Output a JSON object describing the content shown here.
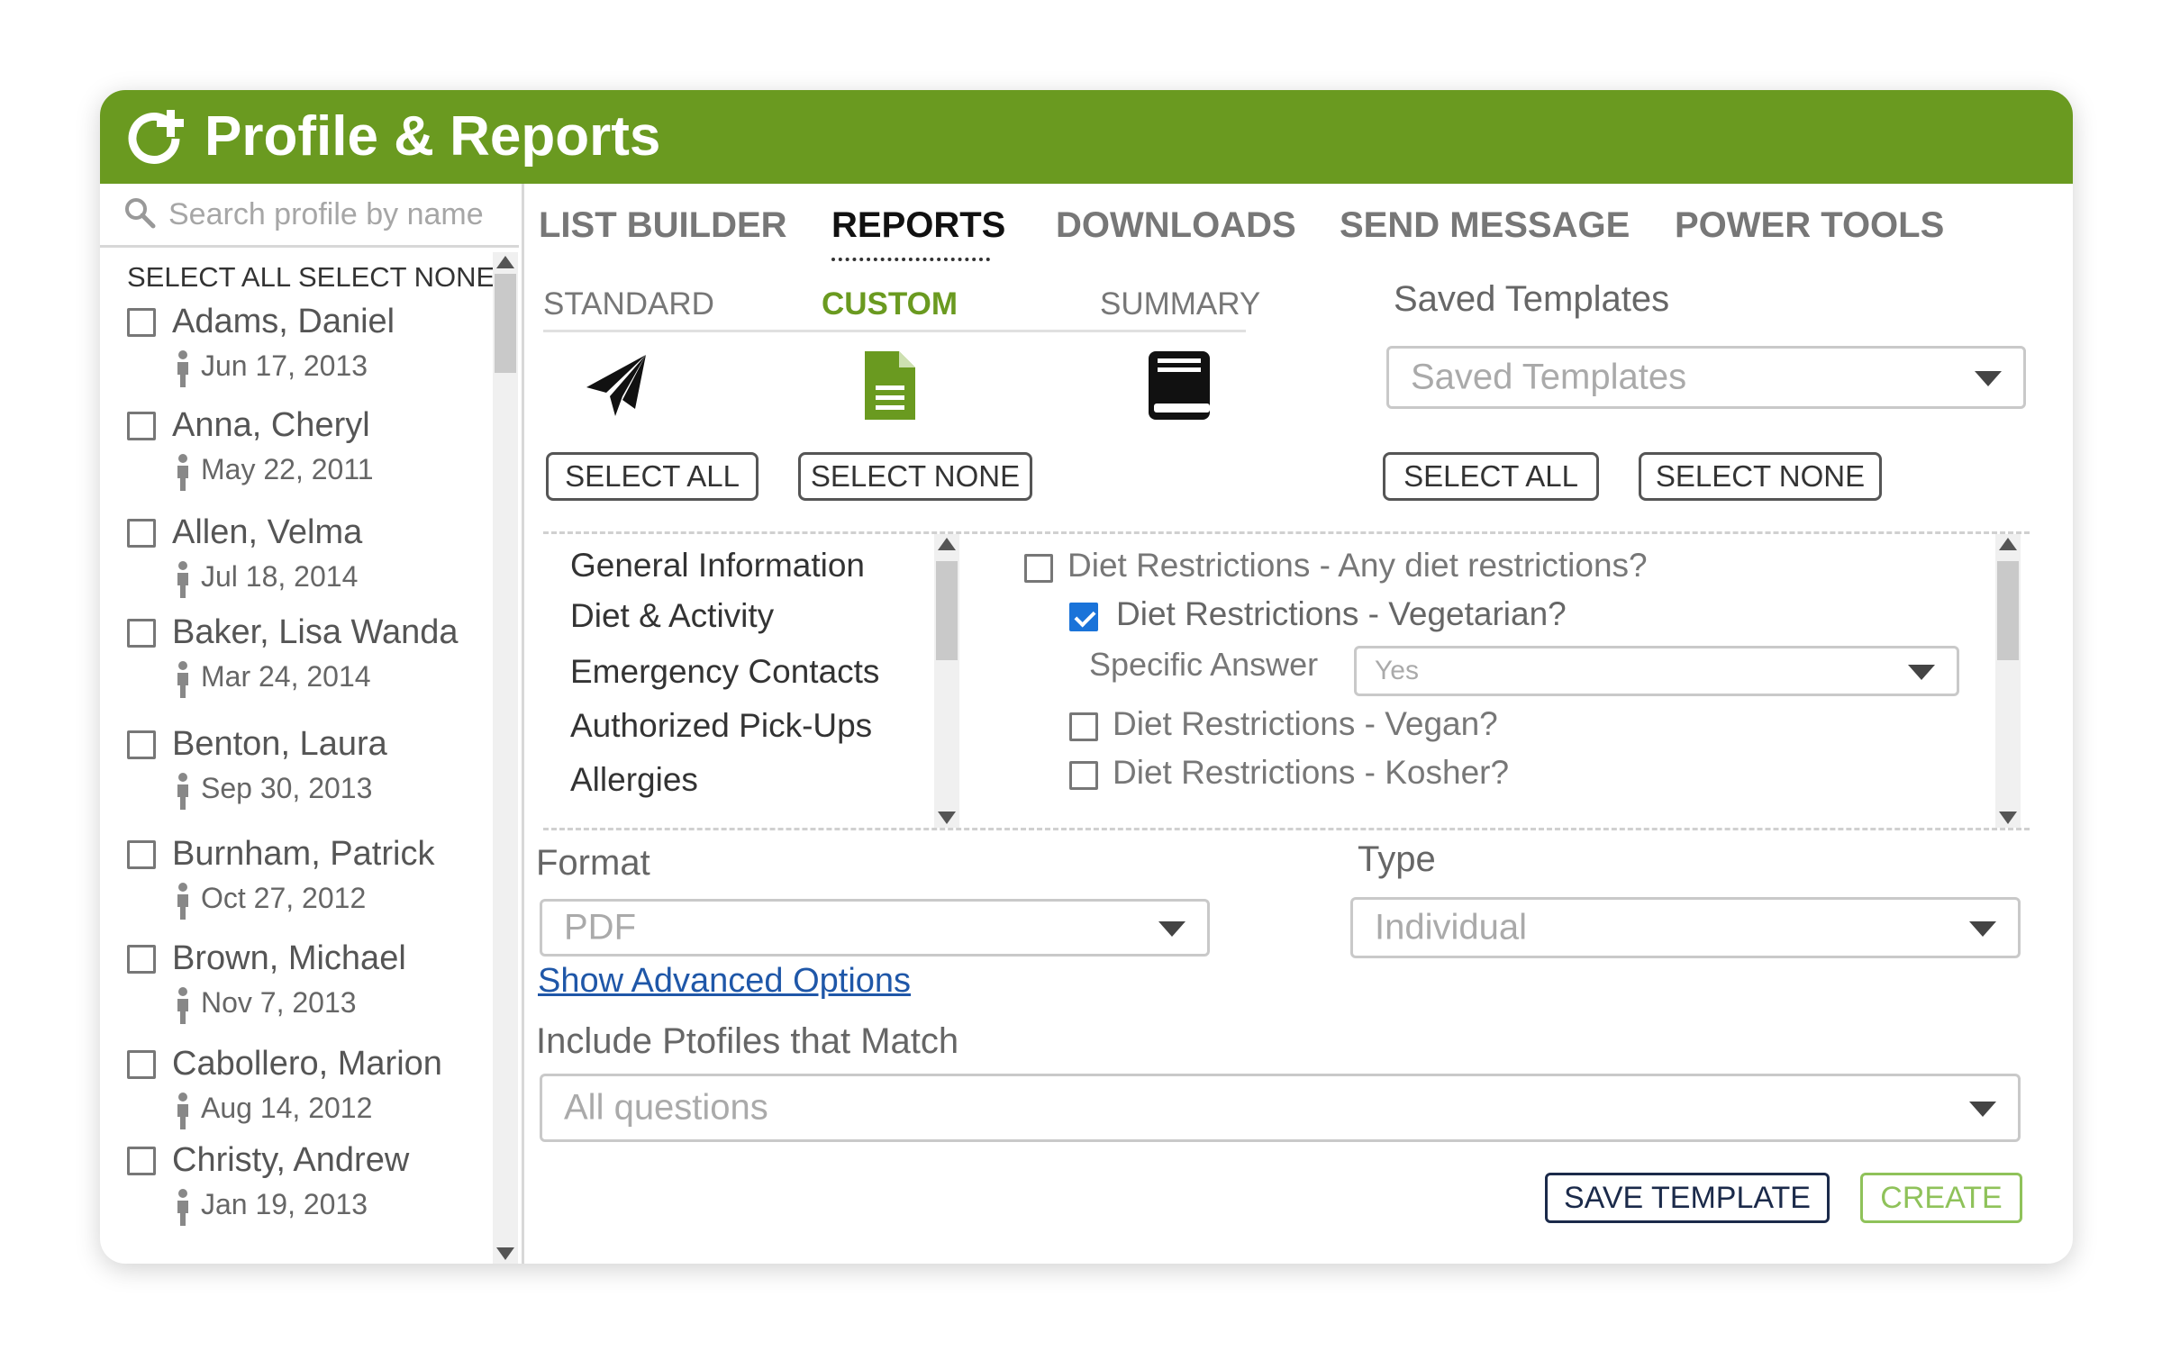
{
  "app": {
    "title": "Profile & Reports"
  },
  "sidebar": {
    "search_placeholder": "Search profile by name",
    "select_all": "SELECT ALL",
    "select_none": "SELECT NONE",
    "profiles": [
      {
        "name": "Adams, Daniel",
        "date": "Jun 17, 2013"
      },
      {
        "name": "Anna, Cheryl",
        "date": "May 22, 2011"
      },
      {
        "name": "Allen, Velma",
        "date": "Jul 18, 2014"
      },
      {
        "name": "Baker, Lisa Wanda",
        "date": "Mar 24, 2014"
      },
      {
        "name": "Benton, Laura",
        "date": "Sep 30, 2013"
      },
      {
        "name": "Burnham, Patrick",
        "date": "Oct 27, 2012"
      },
      {
        "name": "Brown, Michael",
        "date": "Nov 7, 2013"
      },
      {
        "name": "Cabollero, Marion",
        "date": "Aug 14, 2012"
      },
      {
        "name": "Christy, Andrew",
        "date": "Jan 19, 2013"
      }
    ]
  },
  "tabs": [
    "LIST BUILDER",
    "REPORTS",
    "DOWNLOADS",
    "SEND MESSAGE",
    "POWER TOOLS"
  ],
  "subtabs": [
    "STANDARD",
    "CUSTOM",
    "SUMMARY"
  ],
  "report_buttons": {
    "select_all": "SELECT ALL",
    "select_none": "SELECT NONE"
  },
  "templates": {
    "label": "Saved Templates",
    "select_value": "Saved Templates",
    "select_all": "SELECT ALL",
    "select_none": "SELECT NONE"
  },
  "categories": [
    "General Information",
    "Diet & Activity",
    "Emergency Contacts",
    "Authorized Pick-Ups",
    "Allergies"
  ],
  "questions": {
    "q1": "Diet Restrictions - Any diet restrictions?",
    "q2": "Diet Restrictions - Vegetarian?",
    "specific_answer_label": "Specific Answer",
    "specific_answer_value": "Yes",
    "q3": "Diet Restrictions - Vegan?",
    "q4": "Diet Restrictions - Kosher?"
  },
  "format": {
    "label": "Format",
    "value": "PDF"
  },
  "type": {
    "label": "Type",
    "value": "Individual"
  },
  "advanced_link": "Show Advanced Options",
  "match": {
    "label": "Include Ptofiles that Match",
    "value": "All questions"
  },
  "actions": {
    "save_template": "SAVE TEMPLATE",
    "create": "CREATE"
  },
  "colors": {
    "brand": "#6a9a20",
    "check": "#1a73d9",
    "create": "#8fc25a",
    "link": "#1f57a8"
  }
}
